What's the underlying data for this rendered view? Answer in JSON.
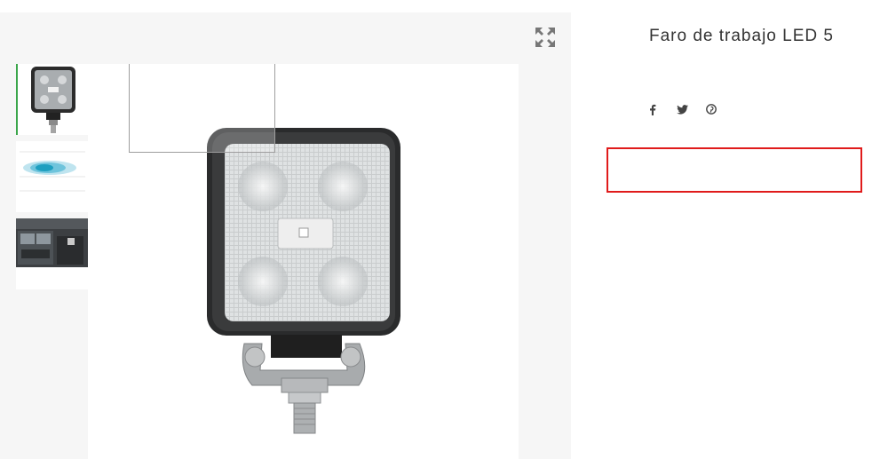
{
  "product": {
    "title": "Faro de trabajo LED 5"
  },
  "gallery": {
    "expand_icon": "expand-icon",
    "thumbnails": [
      {
        "name": "work-light-front",
        "active": true
      },
      {
        "name": "beam-pattern-diagram",
        "active": false
      },
      {
        "name": "truck-mounted-light",
        "active": false
      }
    ],
    "main_image": "led-work-light-square"
  },
  "share": {
    "icons": [
      "facebook-icon",
      "twitter-icon",
      "pinterest-icon"
    ]
  },
  "colors": {
    "active_thumb_border": "#3aa64a",
    "highlight_border": "#e01b1b",
    "gallery_bg": "#f6f6f6"
  }
}
